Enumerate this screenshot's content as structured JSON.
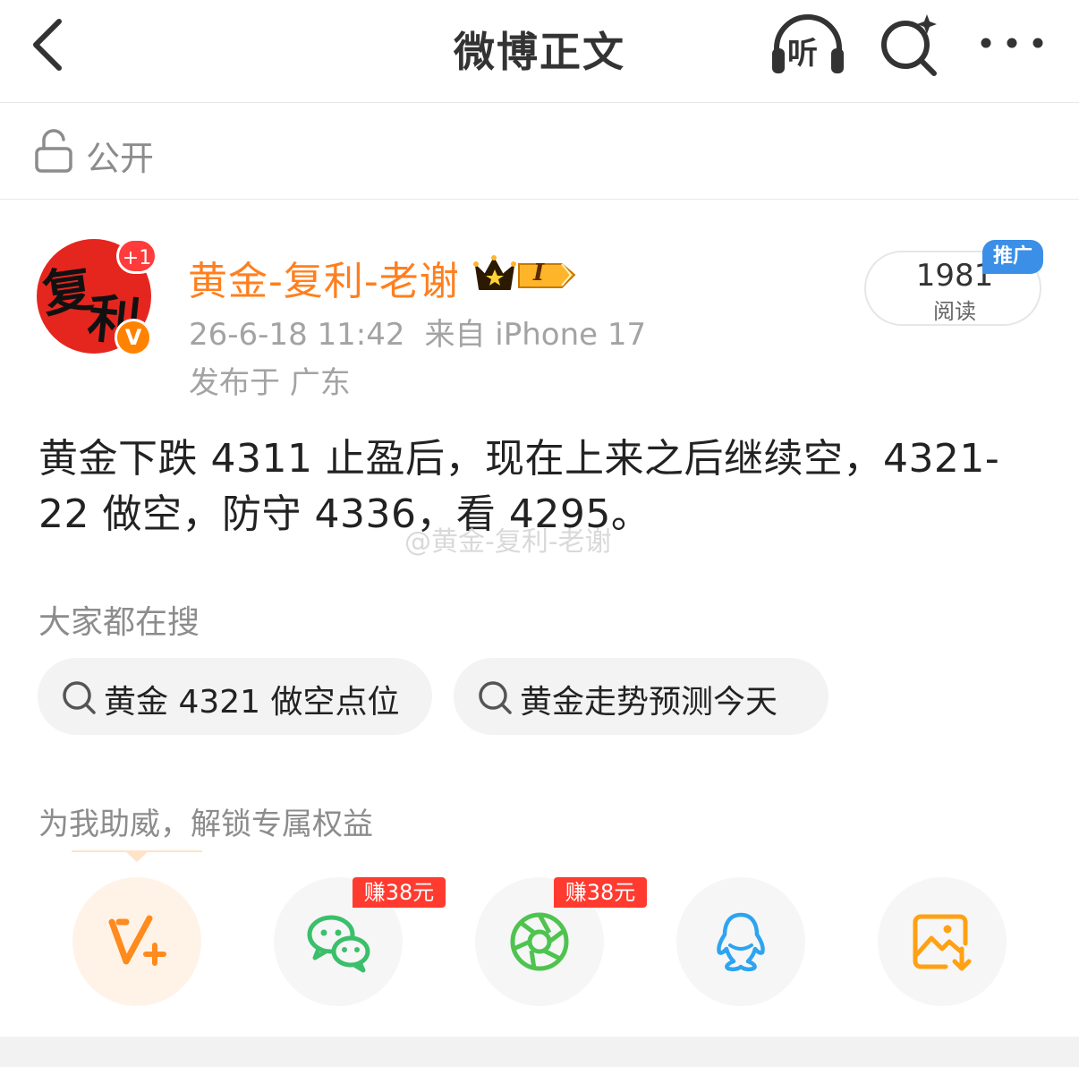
{
  "navbar": {
    "title": "微博正文",
    "listen_label": "听",
    "back_icon": "chevron-left-icon",
    "search_icon": "ai-search-icon",
    "more_icon": "more-dots-icon"
  },
  "visibility": {
    "label": "公开",
    "icon": "unlock-icon"
  },
  "author": {
    "avatar_text_1": "复",
    "avatar_text_2": "利",
    "follow_badge": "+1",
    "verified_badge": "V",
    "name": "黄金-复利-老谢",
    "vip_level": "I",
    "post_time": "26-6-18 11:42",
    "post_source": "来自 iPhone 17",
    "location": "发布于 广东"
  },
  "stats": {
    "read_count": "1981",
    "read_label": "阅读",
    "promo_label": "推广"
  },
  "post": {
    "text": "黄金下跌 4311 止盈后，现在上来之后继续空，4321-22 做空，防守 4336，看 4295。",
    "watermark": "@黄金-复利-老谢"
  },
  "trending": {
    "title": "大家都在搜",
    "chips": [
      {
        "label": "黄金 4321 做空点位"
      },
      {
        "label": "黄金走势预测今天"
      }
    ]
  },
  "support": {
    "title": "为我助威，解锁专属权益",
    "items": [
      {
        "icon": "v-plus-icon",
        "earn": ""
      },
      {
        "icon": "wechat-icon",
        "earn": "赚38元"
      },
      {
        "icon": "moments-icon",
        "earn": "赚38元"
      },
      {
        "icon": "qq-icon",
        "earn": ""
      },
      {
        "icon": "save-image-icon",
        "earn": ""
      }
    ]
  },
  "colors": {
    "accent_orange": "#ff7f1e",
    "promo_blue": "#3b8fe6",
    "earn_red": "#ff3b2f",
    "wechat_green": "#3bbf6b",
    "qq_blue": "#2ea4f0",
    "save_orange": "#ffa114"
  }
}
